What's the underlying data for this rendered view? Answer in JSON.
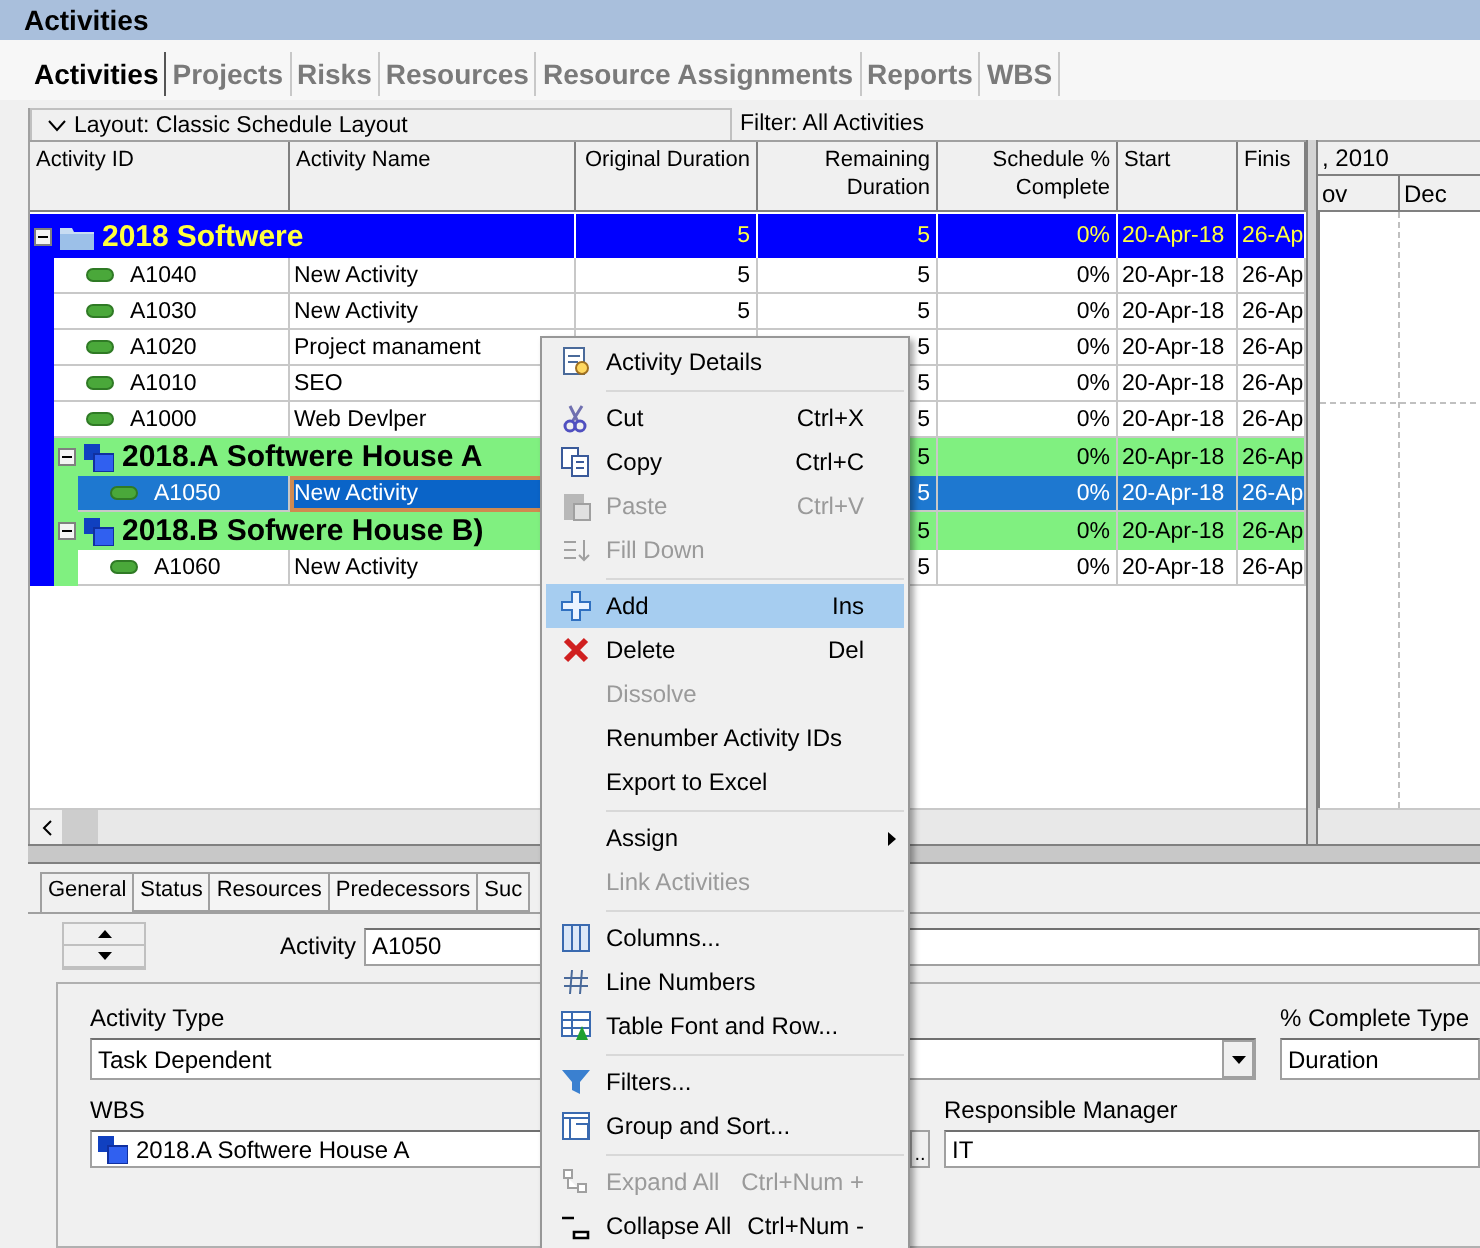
{
  "title": "Activities",
  "tabs": [
    {
      "label": "Activities",
      "selected": true
    },
    {
      "label": "Projects",
      "selected": false
    },
    {
      "label": "Risks",
      "selected": false
    },
    {
      "label": "Resources",
      "selected": false
    },
    {
      "label": "Resource Assignments",
      "selected": false
    },
    {
      "label": "Reports",
      "selected": false
    },
    {
      "label": "WBS",
      "selected": false
    }
  ],
  "layout_bar": {
    "layout": "Layout: Classic Schedule Layout",
    "filter": "Filter: All Activities"
  },
  "table": {
    "columns": [
      "Activity ID",
      "Activity Name",
      "Original Duration",
      "Remaining Duration",
      "Schedule % Complete",
      "Start",
      "Finis"
    ],
    "rows": [
      {
        "kind": "group",
        "code": "2018",
        "name": "Softwere",
        "color": "#0000ff",
        "expanded": true,
        "original_duration": "5",
        "remaining_duration": "5",
        "schedule_complete": "0%",
        "start": "20-Apr-18",
        "finish": "26-Ap",
        "children": [
          {
            "kind": "activity",
            "id": "A1040",
            "name": "New Activity",
            "original_duration": "5",
            "remaining_duration": "5",
            "schedule_complete": "0%",
            "start": "20-Apr-18",
            "finish": "26-Ap",
            "selected": false
          },
          {
            "kind": "activity",
            "id": "A1030",
            "name": "New Activity",
            "original_duration": "5",
            "remaining_duration": "5",
            "schedule_complete": "0%",
            "start": "20-Apr-18",
            "finish": "26-Ap",
            "selected": false
          },
          {
            "kind": "activity",
            "id": "A1020",
            "name": "Project manament",
            "remaining_duration": "5",
            "schedule_complete": "0%",
            "start": "20-Apr-18",
            "finish": "26-Ap",
            "selected": false
          },
          {
            "kind": "activity",
            "id": "A1010",
            "name": "SEO",
            "remaining_duration": "5",
            "schedule_complete": "0%",
            "start": "20-Apr-18",
            "finish": "26-Ap",
            "selected": false
          },
          {
            "kind": "activity",
            "id": "A1000",
            "name": "Web Devlper",
            "remaining_duration": "5",
            "schedule_complete": "0%",
            "start": "20-Apr-18",
            "finish": "26-Ap",
            "selected": false
          },
          {
            "kind": "group",
            "code": "2018.A",
            "name": "Softwere House A",
            "color": "#80f080",
            "expanded": true,
            "remaining_duration": "5",
            "schedule_complete": "0%",
            "start": "20-Apr-18",
            "finish": "26-Ap",
            "children": [
              {
                "kind": "activity",
                "id": "A1050",
                "name": "New Activity",
                "remaining_duration": "5",
                "schedule_complete": "0%",
                "start": "20-Apr-18",
                "finish": "26-Ap",
                "selected": true
              }
            ]
          },
          {
            "kind": "group",
            "code": "2018.B",
            "name": "Sofwere House B)",
            "color": "#80f080",
            "expanded": true,
            "remaining_duration": "5",
            "schedule_complete": "0%",
            "start": "20-Apr-18",
            "finish": "26-Ap",
            "children": [
              {
                "kind": "activity",
                "id": "A1060",
                "name": "New Activity",
                "remaining_duration": "5",
                "schedule_complete": "0%",
                "start": "20-Apr-18",
                "finish": "26-Ap",
                "selected": false
              }
            ]
          }
        ]
      }
    ]
  },
  "gantt": {
    "year": ", 2010",
    "months": [
      "ov",
      "Dec"
    ]
  },
  "details": {
    "tabs": [
      {
        "label": "General",
        "selected": true
      },
      {
        "label": "Status",
        "selected": false
      },
      {
        "label": "Resources",
        "selected": false
      },
      {
        "label": "Predecessors",
        "selected": false
      },
      {
        "label": "Suc",
        "selected": false
      }
    ],
    "activity_label": "Activity",
    "activity_value": "A1050",
    "rows": [
      {
        "fields": [
          {
            "kind": "dropdown",
            "label": "Activity Type",
            "value": "Task Dependent"
          },
          {
            "kind": "text",
            "label": "% Complete Type",
            "value": "Duration"
          }
        ]
      },
      {
        "fields": [
          {
            "kind": "lookup",
            "label": "WBS",
            "value": "2018.A  Softwere House A",
            "button": ".."
          },
          {
            "kind": "text",
            "label": "Responsible Manager",
            "value": "IT"
          }
        ]
      }
    ]
  },
  "context_menu": {
    "items": [
      {
        "kind": "item",
        "label": "Activity Details",
        "disabled": false,
        "selected": false
      },
      {
        "kind": "separator"
      },
      {
        "kind": "item",
        "label": "Cut",
        "shortcut": "Ctrl+X",
        "disabled": false,
        "selected": false
      },
      {
        "kind": "item",
        "label": "Copy",
        "shortcut": "Ctrl+C",
        "disabled": false,
        "selected": false
      },
      {
        "kind": "item",
        "label": "Paste",
        "shortcut": "Ctrl+V",
        "disabled": true,
        "selected": false
      },
      {
        "kind": "item",
        "label": "Fill Down",
        "disabled": true,
        "selected": false
      },
      {
        "kind": "separator"
      },
      {
        "kind": "item",
        "label": "Add",
        "shortcut": "Ins",
        "disabled": false,
        "selected": true
      },
      {
        "kind": "item",
        "label": "Delete",
        "shortcut": "Del",
        "disabled": false,
        "selected": false
      },
      {
        "kind": "item",
        "label": "Dissolve",
        "disabled": true,
        "selected": false
      },
      {
        "kind": "item",
        "label": "Renumber Activity IDs",
        "disabled": false,
        "selected": false
      },
      {
        "kind": "item",
        "label": "Export to Excel",
        "disabled": false,
        "selected": false
      },
      {
        "kind": "separator"
      },
      {
        "kind": "item",
        "label": "Assign",
        "submenu": true,
        "disabled": false,
        "selected": false
      },
      {
        "kind": "item",
        "label": "Link Activities",
        "disabled": true,
        "selected": false
      },
      {
        "kind": "separator"
      },
      {
        "kind": "item",
        "label": "Columns...",
        "disabled": false,
        "selected": false
      },
      {
        "kind": "item",
        "label": "Line Numbers",
        "disabled": false,
        "selected": false
      },
      {
        "kind": "item",
        "label": "Table Font and Row...",
        "disabled": false,
        "selected": false
      },
      {
        "kind": "separator"
      },
      {
        "kind": "item",
        "label": "Filters...",
        "disabled": false,
        "selected": false
      },
      {
        "kind": "item",
        "label": "Group and Sort...",
        "disabled": false,
        "selected": false
      },
      {
        "kind": "separator"
      },
      {
        "kind": "item",
        "label": "Expand All",
        "shortcut": "Ctrl+Num +",
        "disabled": true,
        "selected": false
      },
      {
        "kind": "item",
        "label": "Collapse All",
        "shortcut": "Ctrl+Num -",
        "disabled": false,
        "selected": false
      }
    ]
  }
}
